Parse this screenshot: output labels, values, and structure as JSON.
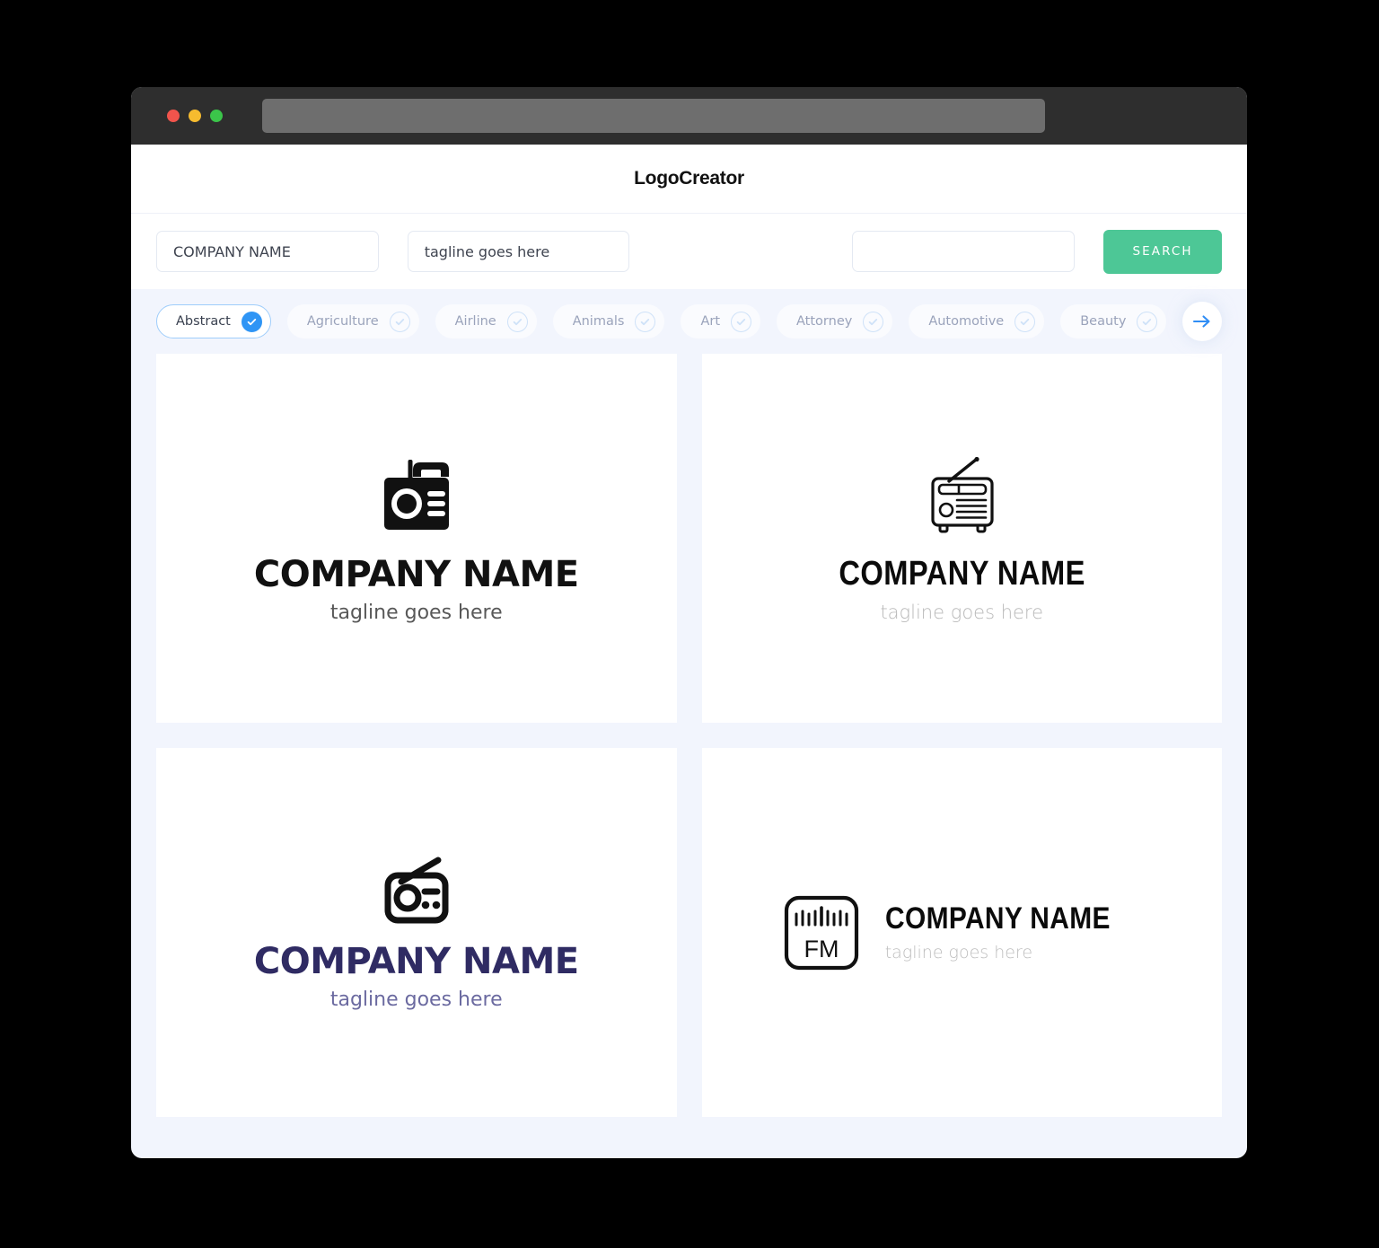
{
  "browser": {
    "url_value": "",
    "traffic_lights": [
      "close-red",
      "minimize-yellow",
      "maximize-green"
    ]
  },
  "header": {
    "brand": "LogoCreator"
  },
  "search": {
    "company_value": "COMPANY NAME",
    "company_placeholder": "COMPANY NAME",
    "tagline_value": "tagline goes here",
    "tagline_placeholder": "tagline goes here",
    "extra_value": "",
    "extra_placeholder": "",
    "button_label": "SEARCH",
    "button_color": "#4dc796"
  },
  "filters": {
    "accent_color": "#2f95f5",
    "next_arrow": "arrow-right-icon",
    "chips": [
      {
        "label": "Abstract",
        "selected": true
      },
      {
        "label": "Agriculture",
        "selected": false
      },
      {
        "label": "Airline",
        "selected": false
      },
      {
        "label": "Animals",
        "selected": false
      },
      {
        "label": "Art",
        "selected": false
      },
      {
        "label": "Attorney",
        "selected": false
      },
      {
        "label": "Automotive",
        "selected": false
      },
      {
        "label": "Beauty",
        "selected": false
      }
    ]
  },
  "results": [
    {
      "icon": "radio-solid-icon",
      "name": "COMPANY NAME",
      "tagline": "tagline goes here",
      "name_color": "#111111",
      "tagline_color": "#585858",
      "layout": "stacked"
    },
    {
      "icon": "vintage-radio-outline-icon",
      "name": "COMPANY NAME",
      "tagline": "tagline goes here",
      "name_color": "#0b0b0b",
      "tagline_color": "#b9b9b9",
      "layout": "stacked"
    },
    {
      "icon": "radio-outline-antenna-icon",
      "name": "COMPANY NAME",
      "tagline": "tagline goes here",
      "name_color": "#2f2b63",
      "tagline_color": "#6b6aa0",
      "layout": "stacked"
    },
    {
      "icon": "fm-tuner-icon",
      "icon_text": "FM",
      "name": "COMPANY NAME",
      "tagline": "tagline goes here",
      "name_color": "#0b0b0b",
      "tagline_color": "#bdbdbd",
      "layout": "horizontal"
    }
  ]
}
